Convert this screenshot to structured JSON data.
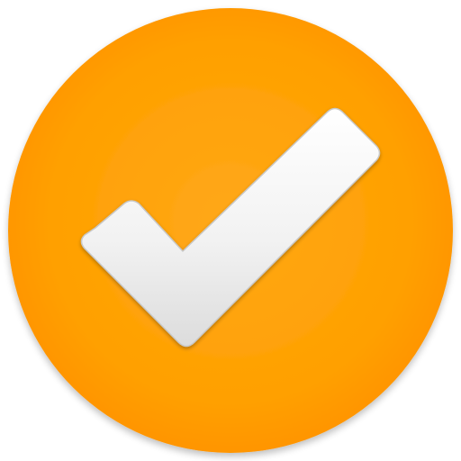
{
  "icon": {
    "name": "check-mark-icon",
    "colors": {
      "circle_center": "#FFA81A",
      "circle_mid": "#FFA000",
      "circle_edge": "#FF9500",
      "check_top": "#FFFFFF",
      "check_bottom": "#DCDCDC",
      "check_stroke": "#C8C8C8",
      "shadow": "#000000"
    }
  }
}
